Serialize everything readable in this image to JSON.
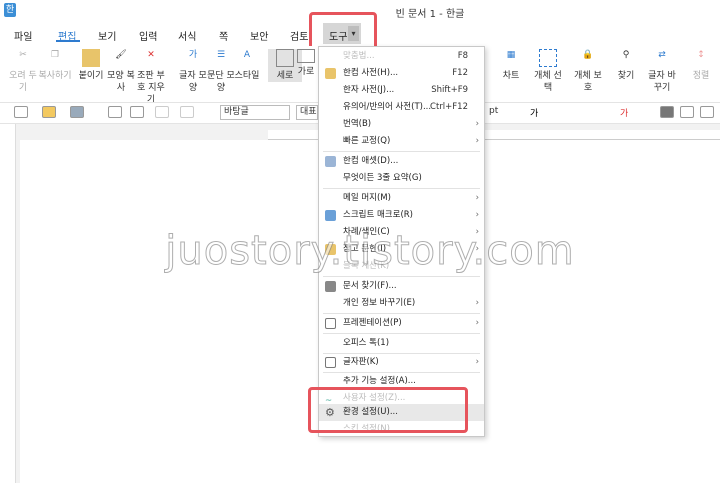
{
  "window": {
    "title": "빈 문서 1 - 한글",
    "app_icon": "한"
  },
  "menubar": {
    "items": [
      "파일",
      "편집",
      "보기",
      "입력",
      "서식",
      "쪽",
      "보안",
      "검토",
      "도구"
    ],
    "active": "편집"
  },
  "ribbon": {
    "items": [
      "오려 두기",
      "복사하기",
      "붙이기",
      "모양 복사",
      "조판 부호 지우기",
      "글자 모양",
      "문단 모양",
      "스타일",
      "세로",
      "가로"
    ],
    "right_items": [
      "차트",
      "개체 선택",
      "개체 보호",
      "찾기",
      "글자 바꾸기",
      "정렬"
    ]
  },
  "toolbar": {
    "font": "바탕글",
    "style": "대표",
    "size_unit": "pt"
  },
  "context_menu": {
    "items": [
      {
        "label": "맞춤법...",
        "shortcut": "F8",
        "faded": true
      },
      {
        "label": "한컴 사전(H)...",
        "shortcut": "F12"
      },
      {
        "label": "한자 사전(J)...",
        "shortcut": "Shift+F9"
      },
      {
        "label": "유의어/반의어 사전(T)...",
        "shortcut": "Ctrl+F12"
      },
      {
        "label": "번역(B)",
        "submenu": true
      },
      {
        "label": "빠른 교정(Q)",
        "submenu": true
      },
      {
        "label": "한컴 애셋(D)..."
      },
      {
        "label": "무엇이든 3줄 요약(G)"
      },
      {
        "label": "메일 머지(M)",
        "submenu": true
      },
      {
        "label": "스크립트 매크로(R)",
        "submenu": true
      },
      {
        "label": "차례/색인(C)",
        "submenu": true
      },
      {
        "label": "참고 문헌(I)",
        "submenu": true
      },
      {
        "label": "블록 계산(K)",
        "faded": true
      },
      {
        "label": "문서 찾기(F)..."
      },
      {
        "label": "개인 정보 바꾸기(E)",
        "submenu": true
      },
      {
        "label": "프레젠테이션(P)",
        "submenu": true
      },
      {
        "label": "오피스 톡(1)"
      },
      {
        "label": "글자판(K)",
        "submenu": true
      },
      {
        "label": "추가 기능 설정(A)..."
      },
      {
        "label": "사용자 설정(Z)...",
        "faded": true
      },
      {
        "label": "환경 설정(U)..."
      },
      {
        "label": "스킨 설정(N)",
        "faded": true
      }
    ]
  },
  "watermark": "juostory.tistory.com",
  "colors": {
    "accent": "#2e7bcf",
    "highlight_box": "#e6545c"
  }
}
